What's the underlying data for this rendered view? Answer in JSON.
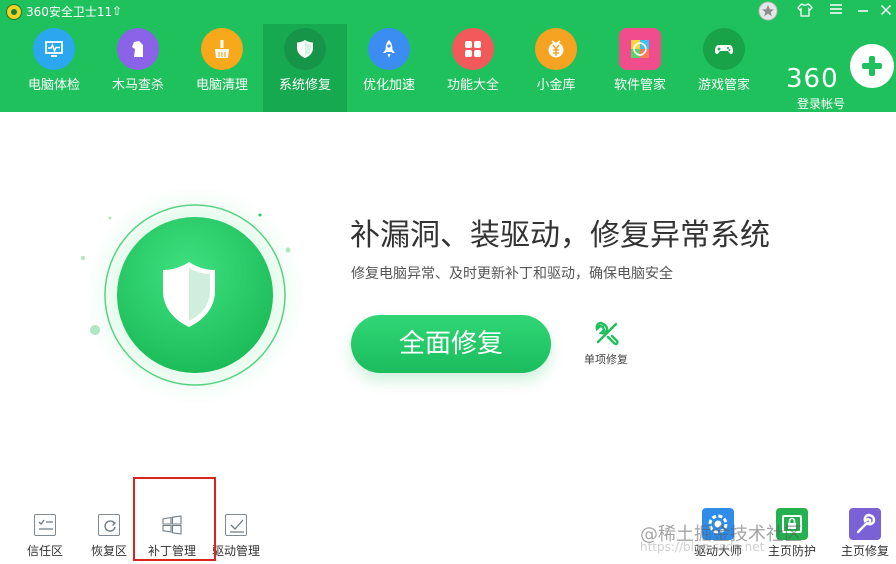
{
  "titlebar": {
    "title": "360安全卫士11",
    "controls": [
      "star-icon",
      "skin-icon",
      "menu-icon",
      "minimize-icon",
      "close-icon"
    ]
  },
  "toolbar": {
    "items": [
      {
        "label": "电脑体检",
        "icon": "monitor-check-icon",
        "color": "#2aa7ee"
      },
      {
        "label": "木马查杀",
        "icon": "horse-icon",
        "color": "#8a63e8"
      },
      {
        "label": "电脑清理",
        "icon": "broom-icon",
        "color": "#f7a81b"
      },
      {
        "label": "系统修复",
        "icon": "shield-icon",
        "color": "#169447"
      },
      {
        "label": "优化加速",
        "icon": "rocket-icon",
        "color": "#3b8df2"
      },
      {
        "label": "功能大全",
        "icon": "grid-icon",
        "color": "#f2595b"
      },
      {
        "label": "小金库",
        "icon": "coin-icon",
        "color": "#f5a320"
      },
      {
        "label": "软件管家",
        "icon": "apps-icon",
        "color": "#ef4d8b"
      },
      {
        "label": "游戏管家",
        "icon": "gamepad-icon",
        "color": "#18a348"
      }
    ],
    "active_index": 3,
    "brand": "360",
    "account_label": "登录帐号"
  },
  "hero": {
    "heading": "补漏洞、装驱动，修复异常系统",
    "subheading": "修复电脑异常、及时更新补丁和驱动，确保电脑安全",
    "primary_button": "全面修复",
    "secondary_label": "单项修复"
  },
  "bottom_left_tools": [
    {
      "label": "信任区",
      "icon": "trust-list-icon"
    },
    {
      "label": "恢复区",
      "icon": "restore-icon"
    },
    {
      "label": "补丁管理",
      "icon": "windows-icon"
    },
    {
      "label": "驱动管理",
      "icon": "driver-check-icon"
    }
  ],
  "bottom_right_tools": [
    {
      "label": "驱动大师",
      "icon": "gear-icon",
      "color": "#2f8ce8"
    },
    {
      "label": "主页防护",
      "icon": "home-lock-icon",
      "color": "#23b04f"
    },
    {
      "label": "主页修复",
      "icon": "wrench-icon",
      "color": "#7a62d6"
    }
  ],
  "watermark": {
    "text": "@稀土掘金技术社区",
    "url": "https://blog.csdn.net"
  },
  "colors": {
    "brand_green": "#1fc15c",
    "active_tab": "#17a94f",
    "highlight_red": "#d9241f"
  }
}
